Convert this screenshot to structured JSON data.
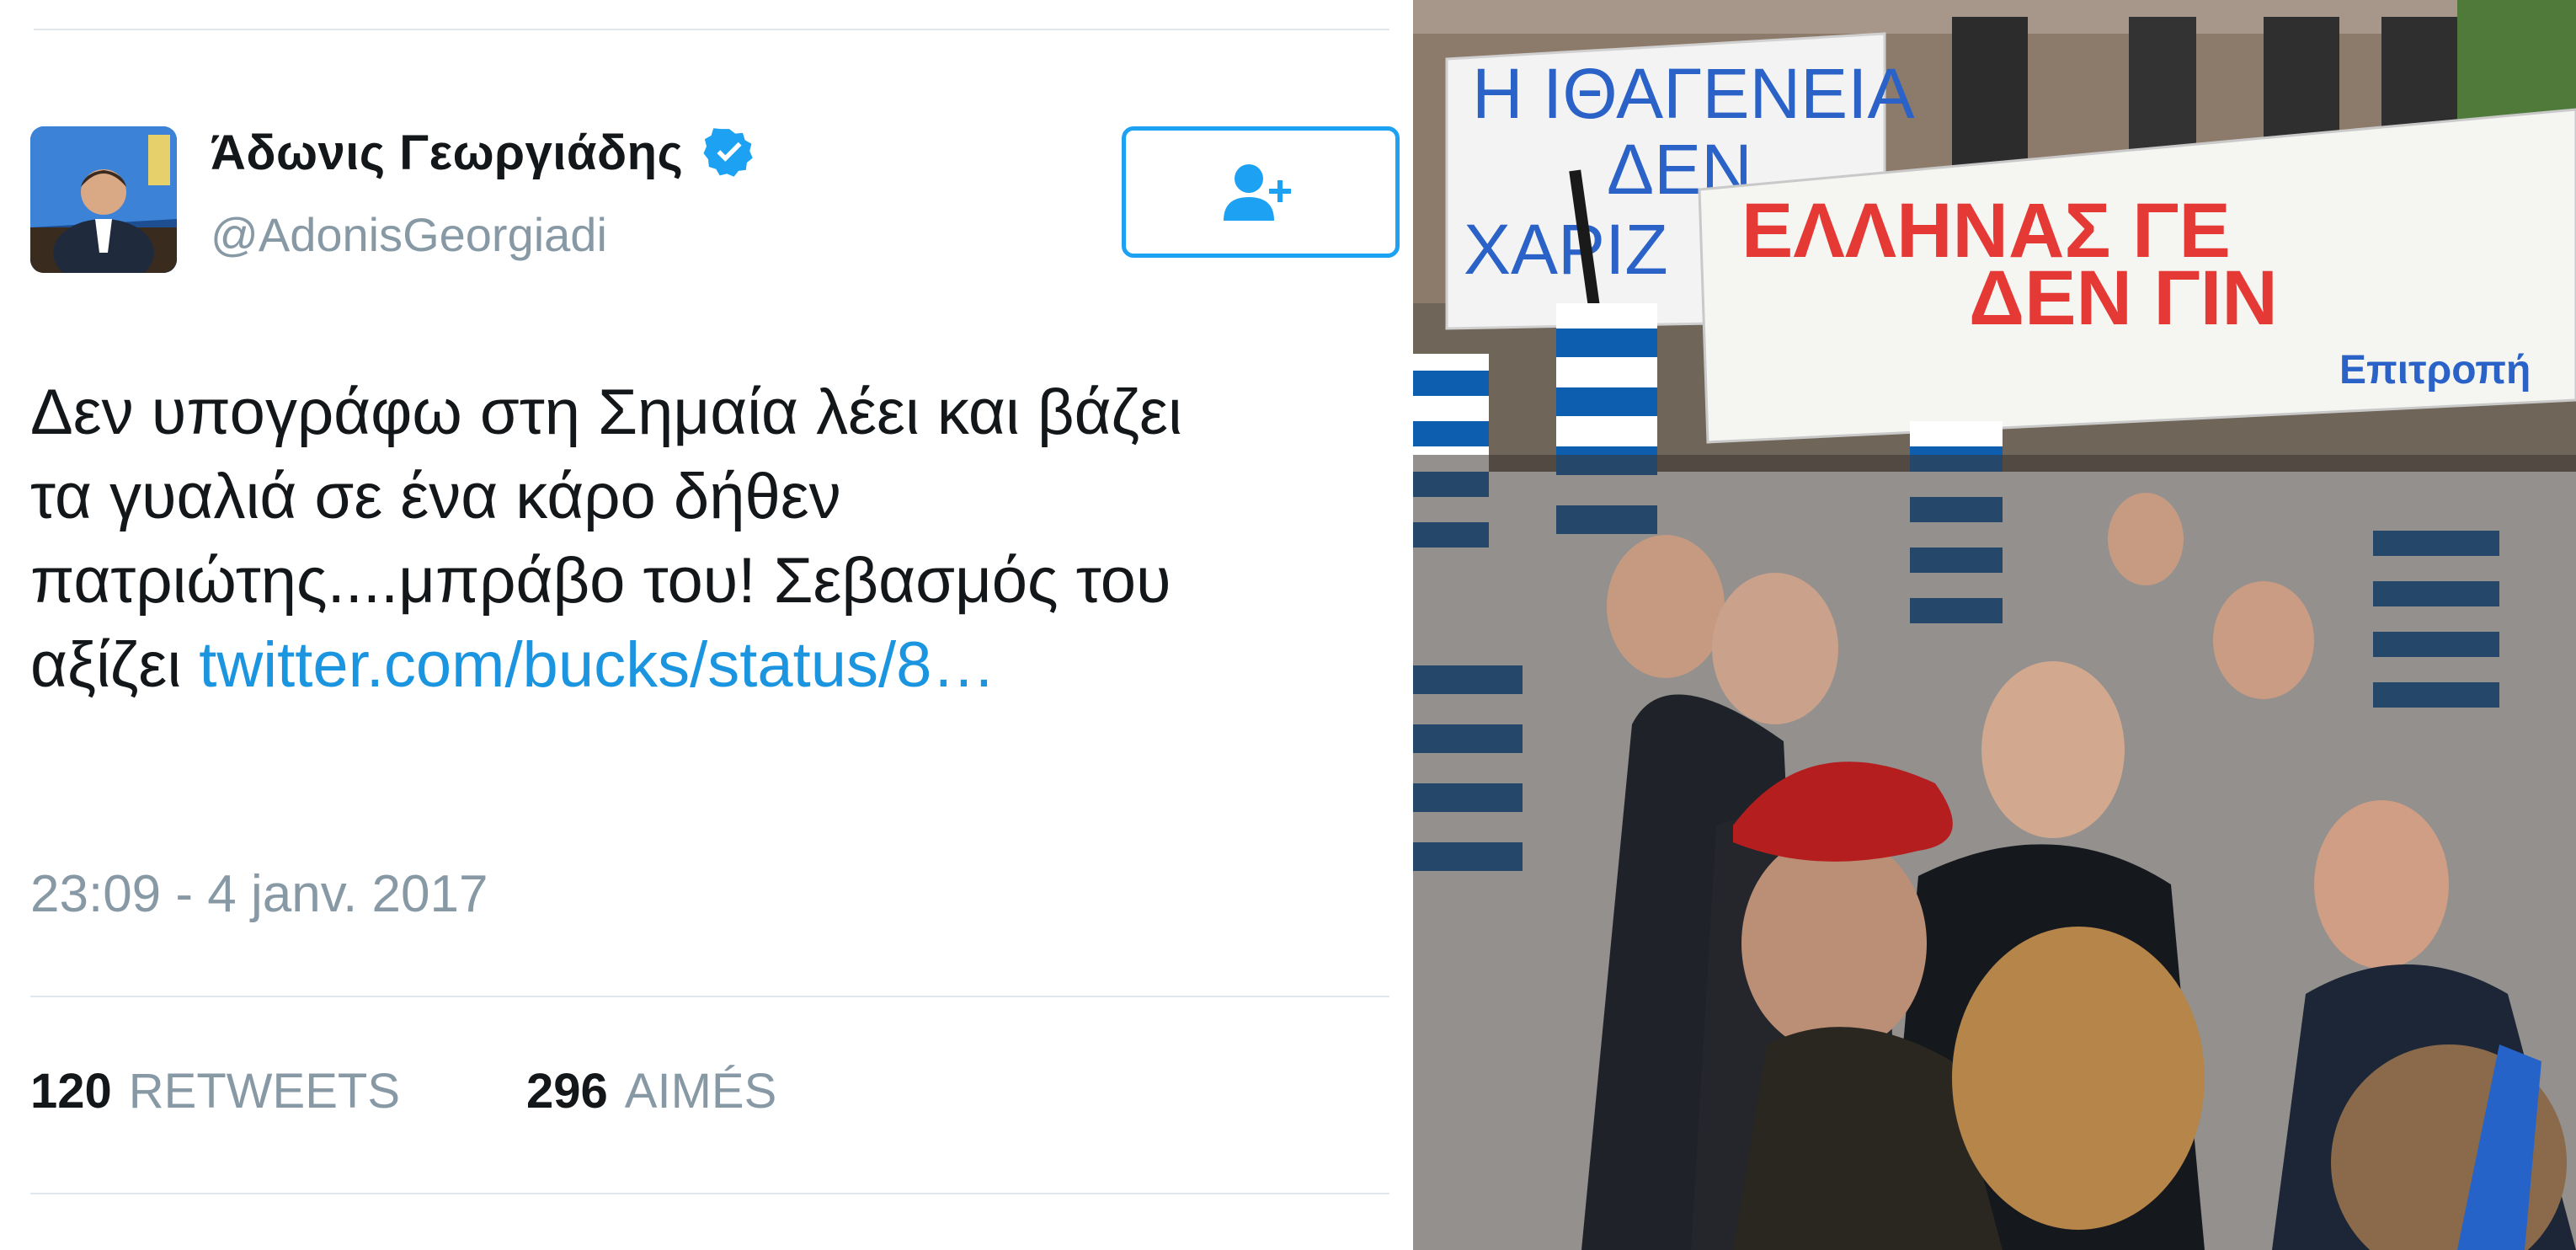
{
  "tweet": {
    "display_name": "Άδωνις Γεωργιάδης",
    "handle": "@AdonisGeorgiadi",
    "verified": true,
    "body_lines": [
      "Δεν υπογράφω στη Σημαία λέει και βάζει",
      "τα γυαλιά σε ένα κάρο δήθεν",
      "πατριώτης....μπράβο του! Σεβασμός του",
      "αξίζει "
    ],
    "link_text": "twitter.com/bucks/status/8…",
    "timestamp": "23:09 - 4 janv. 2017",
    "retweets_count": "120",
    "retweets_label": "RETWEETS",
    "likes_count": "296",
    "likes_label": "AIMÉS",
    "accent_color": "#1da1f2",
    "link_color": "#1b95e0",
    "muted_color": "#8899a6"
  },
  "photo": {
    "banner_left_lines": [
      "Η ΙΘΑΓΕΝΕΙΑ",
      "ΔΕΝ",
      "ΧΑΡΙΖ"
    ],
    "banner_right_lines": [
      "ΕΛΛΗΝΑΣ ΓΕ",
      "ΔΕΝ ΓΙΝ"
    ],
    "banner_right_sign": "Επιτροπή",
    "banner_text_color": "#e53935",
    "flag_colors": [
      "#0d5eaf",
      "#ffffff"
    ]
  }
}
